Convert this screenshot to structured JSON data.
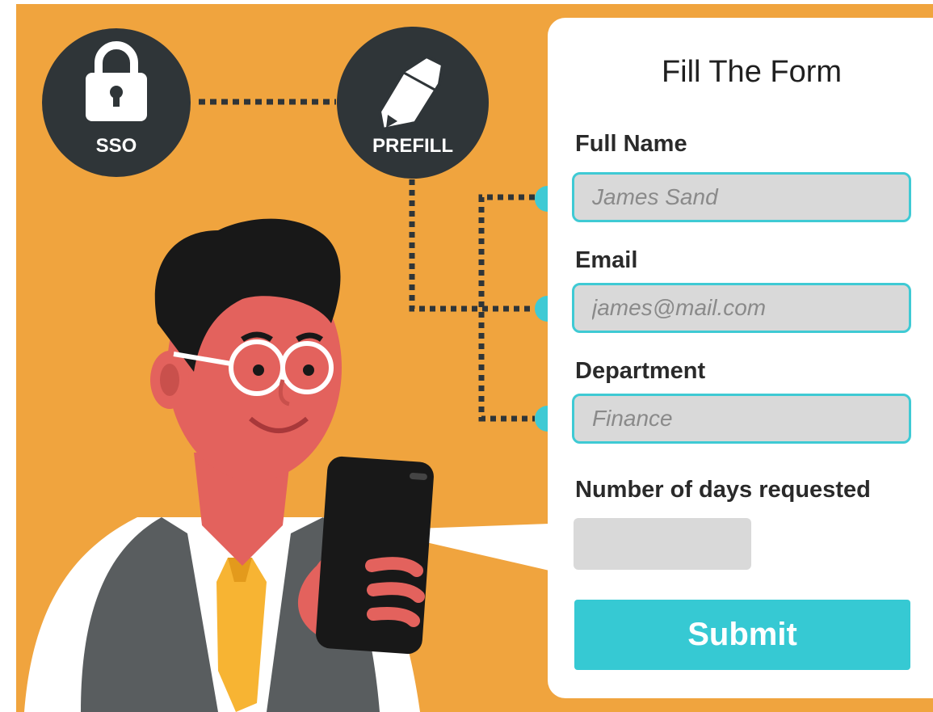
{
  "badges": {
    "sso": {
      "label": "SSO",
      "icon": "lock-icon"
    },
    "prefill": {
      "label": "PREFILL",
      "icon": "pencil-icon"
    }
  },
  "form": {
    "title": "Fill The Form",
    "full_name": {
      "label": "Full Name",
      "placeholder": "James Sand"
    },
    "email": {
      "label": "Email",
      "placeholder": "james@mail.com"
    },
    "department": {
      "label": "Department",
      "placeholder": "Finance"
    },
    "days": {
      "label": "Number of days requested",
      "value": ""
    },
    "submit_label": "Submit"
  },
  "colors": {
    "background": "#f0a43e",
    "badge": "#2f3538",
    "accent": "#36c9d3",
    "input_fill": "#d9d9d9"
  }
}
